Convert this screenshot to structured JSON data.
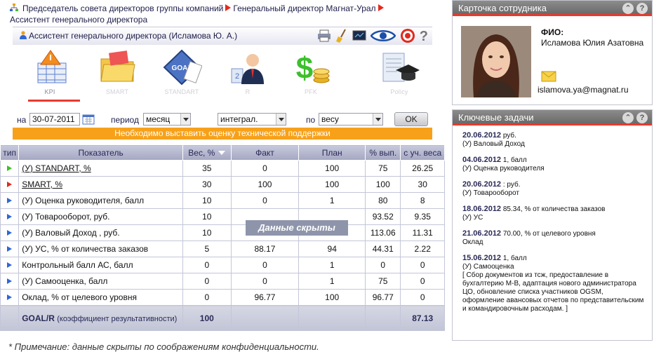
{
  "breadcrumb": {
    "part1": "Председатель совета директоров группы компаний",
    "part2": "Генеральный директор Магнат-Урал",
    "part3": "Ассистент генерального директора"
  },
  "user": {
    "label": "Ассистент генерального директора  (Исламова Ю. А.)"
  },
  "modules": [
    {
      "label": "KPI"
    },
    {
      "label": "SMART"
    },
    {
      "label": "STANDART"
    },
    {
      "label": "R"
    },
    {
      "label": "PFK"
    },
    {
      "label": "Policy"
    }
  ],
  "filters": {
    "date_label": "на",
    "date_value": "30-07-2011",
    "period_label": "период",
    "period_value": "месяц",
    "mode_value": "интеграл.",
    "by_label": "по",
    "by_value": "весу",
    "ok_label": "OK"
  },
  "warning": "Необходимо выставить оценку технической поддержки",
  "table": {
    "headers": [
      "тип",
      "Показатель",
      "Вес, %",
      "Факт",
      "План",
      "% вып.",
      "с уч. веса"
    ],
    "rows": [
      {
        "type": "green",
        "name": "(У) STANDART, %",
        "link": true,
        "weight": "35",
        "fact": "0",
        "plan": "100",
        "pct": "75",
        "weighted": "26.25"
      },
      {
        "type": "red",
        "name": "SMART, %",
        "link": true,
        "weight": "30",
        "fact": "100",
        "plan": "100",
        "pct": "100",
        "weighted": "30"
      },
      {
        "type": "blue",
        "name": "(У) Оценка руководителя, балл",
        "link": false,
        "weight": "10",
        "fact": "0",
        "plan": "1",
        "pct": "80",
        "weighted": "8"
      },
      {
        "type": "blue",
        "name": "(У) Товарооборот, руб.",
        "link": false,
        "weight": "10",
        "fact": "",
        "plan": "",
        "pct": "93.52",
        "weighted": "9.35"
      },
      {
        "type": "blue",
        "name": "(У) Валовый Доход , руб.",
        "link": false,
        "weight": "10",
        "fact": "",
        "plan": "",
        "pct": "113.06",
        "weighted": "11.31"
      },
      {
        "type": "blue",
        "name": "(У) УС, % от количества заказов",
        "link": false,
        "weight": "5",
        "fact": "88.17",
        "plan": "94",
        "pct": "44.31",
        "weighted": "2.22"
      },
      {
        "type": "blue",
        "name": "Контрольный балл АС, балл",
        "link": false,
        "weight": "0",
        "fact": "0",
        "plan": "1",
        "pct": "0",
        "weighted": "0"
      },
      {
        "type": "blue",
        "name": "(У) Самооценка, балл",
        "link": false,
        "weight": "0",
        "fact": "0",
        "plan": "1",
        "pct": "75",
        "weighted": "0"
      },
      {
        "type": "blue",
        "name": "Оклад, % от целевого уровня",
        "link": false,
        "weight": "0",
        "fact": "96.77",
        "plan": "100",
        "pct": "96.77",
        "weighted": "0"
      }
    ],
    "goal": {
      "label": "GOAL/R",
      "sub": "(коэффициент результативности)",
      "weight": "100",
      "weighted": "87.13"
    }
  },
  "hidden_banner": "Данные скрыты",
  "footnote": "* Примечание: данные скрыты по соображениям конфиденциальности.",
  "card": {
    "title": "Карточка сотрудника",
    "fio_label": "ФИО:",
    "name": "Исламова Юлия Азатовна",
    "email": "islamova.ya@magnat.ru"
  },
  "tasks": {
    "title": "Ключевые задачи",
    "items": [
      {
        "date": "20.06.2012",
        "value": "",
        "unit": "руб.",
        "name": "(У) Валовый Доход"
      },
      {
        "date": "04.06.2012",
        "value": "1,",
        "unit": "балл",
        "name": "(У) Оценка руководителя"
      },
      {
        "date": "20.06.2012",
        "value": ":",
        "unit": "руб.",
        "name": "(У) Товарооборот"
      },
      {
        "date": "18.06.2012",
        "value": "85.34,",
        "unit": "% от количества заказов",
        "name": "(У) УС"
      },
      {
        "date": "21.06.2012",
        "value": "70.00,",
        "unit": "% от целевого уровня",
        "name": "Оклад"
      },
      {
        "date": "15.06.2012",
        "value": "1,",
        "unit": "балл",
        "name": "(У) Самооценка",
        "desc": "[ Сбор документов из тсж, предоставление в бухгалтерию М-В, адаптация нового администратора ЦО, обновление списка участников OGSM, оформление авансовых отчетов по представительским и командировочным расходам. ]"
      }
    ]
  }
}
